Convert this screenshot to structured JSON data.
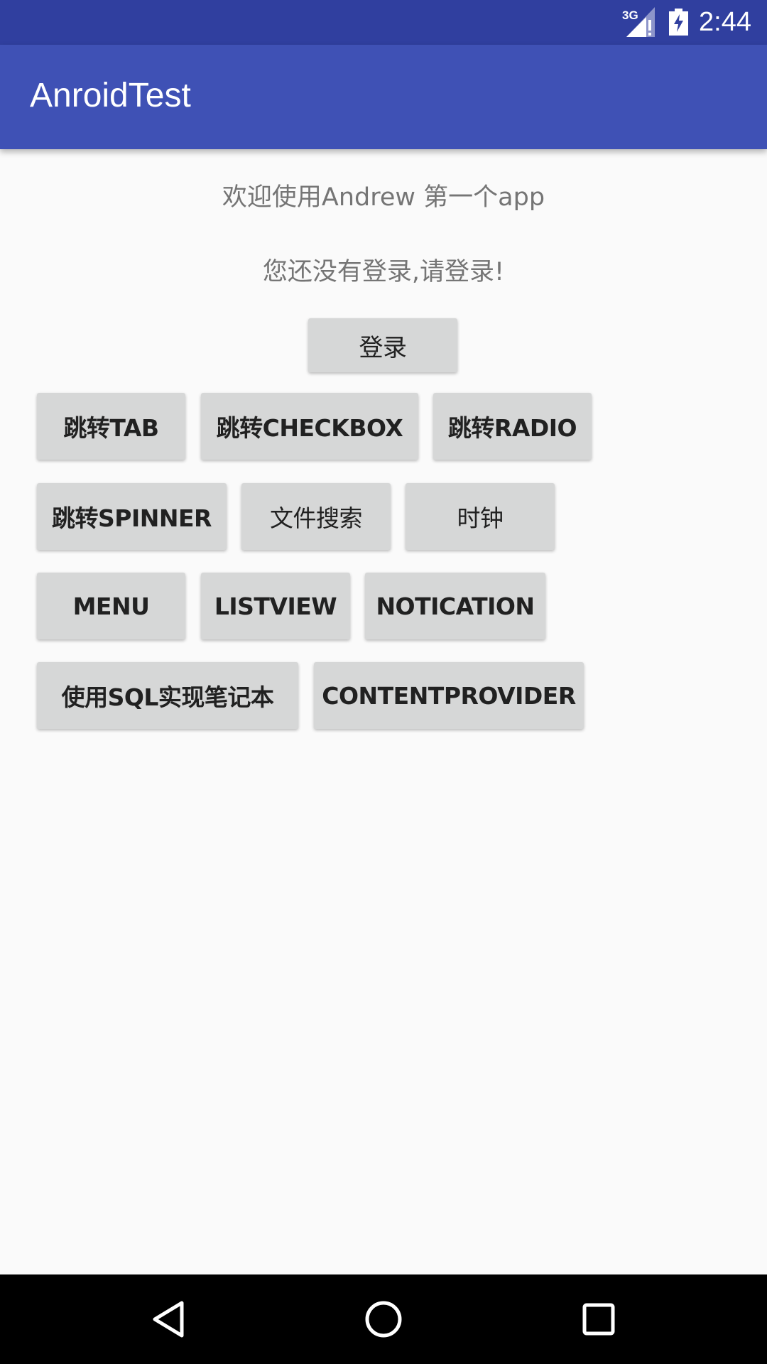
{
  "status_bar": {
    "network": "3G",
    "time": "2:44"
  },
  "app_bar": {
    "title": "AnroidTest"
  },
  "main": {
    "welcome_text": "欢迎使用Andrew 第一个app",
    "login_status_text": "您还没有登录,请登录!",
    "login_button": "登录",
    "buttons": [
      "跳转TAB",
      "跳转CHECKBOX",
      "跳转RADIO",
      "跳转SPINNER",
      "文件搜索",
      "时钟",
      "MENU",
      "LISTVIEW",
      "NOTICATION",
      "使用SQL实现笔记本",
      "CONTENTPROVIDER"
    ]
  },
  "nav_bar": {
    "icons": [
      "back-icon",
      "home-icon",
      "recents-icon"
    ]
  },
  "colors": {
    "status_bar": "#303F9F",
    "app_bar": "#3F51B5",
    "background": "#FAFAFA",
    "button": "#D6D7D7",
    "text_secondary": "#757575"
  }
}
